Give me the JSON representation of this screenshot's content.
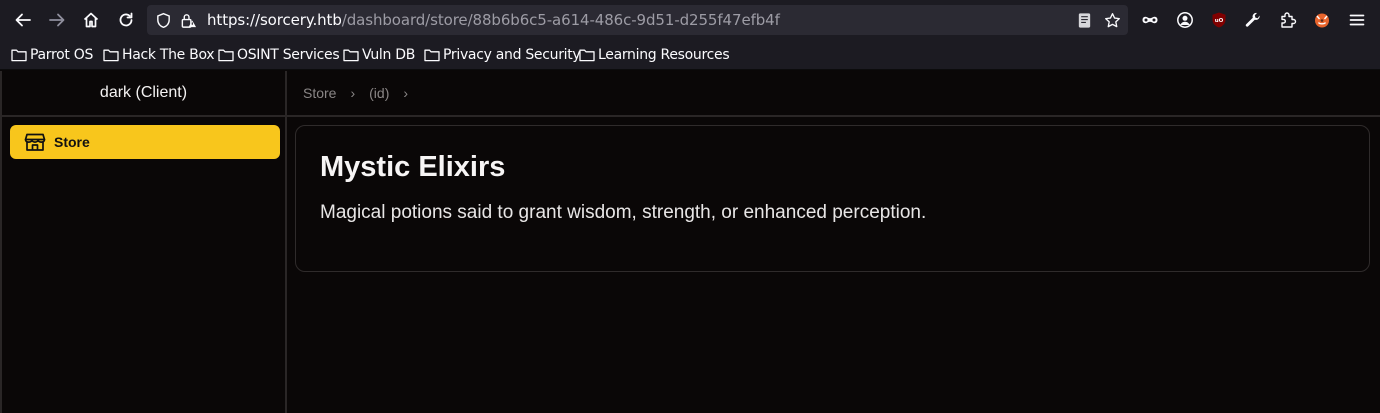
{
  "browser": {
    "url_host": "https://sorcery.htb",
    "url_path": "/dashboard/store/88b6b6c5-a614-486c-9d51-d255f47efb4f",
    "bookmarks": [
      {
        "label": "Parrot OS",
        "icon": "folder-icon"
      },
      {
        "label": "Hack The Box",
        "icon": "folder-icon"
      },
      {
        "label": "OSINT Services",
        "icon": "folder-icon"
      },
      {
        "label": "Vuln DB",
        "icon": "folder-icon"
      },
      {
        "label": "Privacy and Security",
        "icon": "folder-icon"
      },
      {
        "label": "Learning Resources",
        "icon": "folder-icon"
      }
    ]
  },
  "sidebar": {
    "title": "dark (Client)",
    "items": [
      {
        "label": "Store",
        "icon": "store-icon",
        "active": true
      }
    ]
  },
  "breadcrumb": [
    "Store",
    "(id)"
  ],
  "store": {
    "title": "Mystic Elixirs",
    "description": "Magical potions said to grant wisdom, strength, or enhanced perception."
  },
  "colors": {
    "accent": "#f8c61c",
    "background": "#0a0707",
    "chrome": "#1c1b22"
  }
}
